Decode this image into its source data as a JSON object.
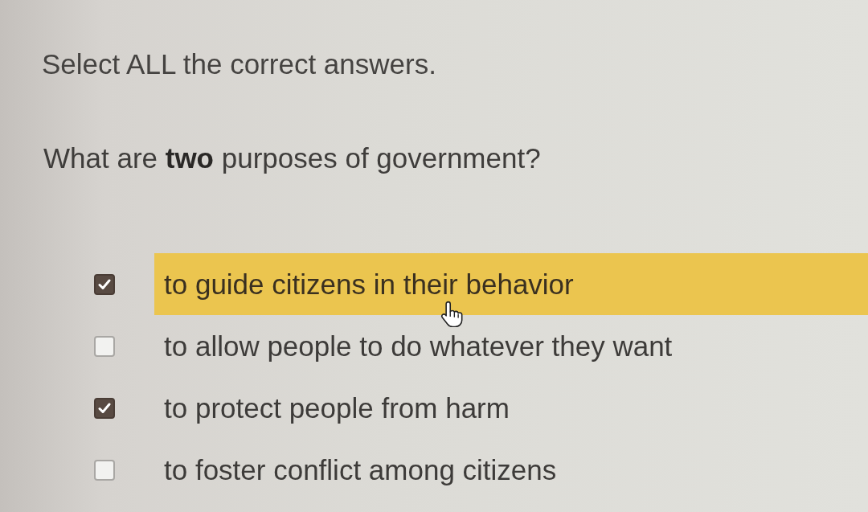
{
  "instruction": "Select ALL the correct answers.",
  "question": "What are **two** purposes of government?",
  "options": [
    {
      "label": "to guide citizens in their behavior",
      "checked": true,
      "hovered": true
    },
    {
      "label": "to allow people to do whatever they want",
      "checked": false,
      "hovered": false
    },
    {
      "label": "to protect people from harm",
      "checked": true,
      "hovered": false
    },
    {
      "label": "to foster conflict among citizens",
      "checked": false,
      "hovered": false
    }
  ]
}
